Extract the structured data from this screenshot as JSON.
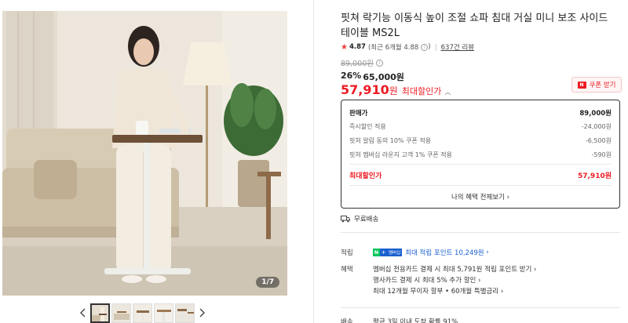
{
  "gallery": {
    "counter": "1/7",
    "thumbnail_count": 5
  },
  "product": {
    "title": "핏쳐 락기능 이동식 높이 조절 쇼파 침대 거실 미니 보조 사이드 테이블 MS2L",
    "rating": "4.87",
    "rating_detail": "(최근 6개월 4.88",
    "review_count": "637건 리뷰",
    "original_price": "89,000원",
    "discount_rate": "26%",
    "discounted_price": "65,000원",
    "final_price": "57,910",
    "final_price_unit": "원",
    "final_price_label": "최대할인가",
    "coupon_button": "쿠폰 받기",
    "coupon_icon_text": "N"
  },
  "breakdown": {
    "rows": [
      {
        "label": "판매가",
        "value": "89,000원"
      },
      {
        "label": "즉시할인 적용",
        "value": "-24,000원"
      },
      {
        "label": "핏쳐 알림 동의 10% 쿠폰 적용",
        "value": "-6,500원"
      },
      {
        "label": "핏쳐 멤버십 라운지 고객 1% 쿠폰 적용",
        "value": "-590원"
      }
    ],
    "total_label": "최대할인가",
    "total_value": "57,910원",
    "view_all_link": "나의 혜택 전체보기"
  },
  "shipping": {
    "label": "무료배송"
  },
  "points": {
    "label": "적립",
    "npay_badge_n": "N",
    "npay_badge_plus": "+",
    "npay_badge_tag": "멤버십",
    "text": "최대 적립 포인트 10,249원"
  },
  "benefits": {
    "label": "혜택",
    "items": [
      "멤버십 전용카드 결제 시 최대 5,791원 적립 포인트 받기",
      "행사카드 결제 시 최대 5% 추가 할인",
      "최대 12개월 무이자 할부 • 60개월 특별금리"
    ]
  },
  "delivery": {
    "label": "배송",
    "text": "평균 3일 이내 도착 확률 91%"
  },
  "colors": {
    "accent_red": "#ee1c25",
    "link_blue": "#1a5fd0",
    "npay_green": "#03c75a"
  }
}
